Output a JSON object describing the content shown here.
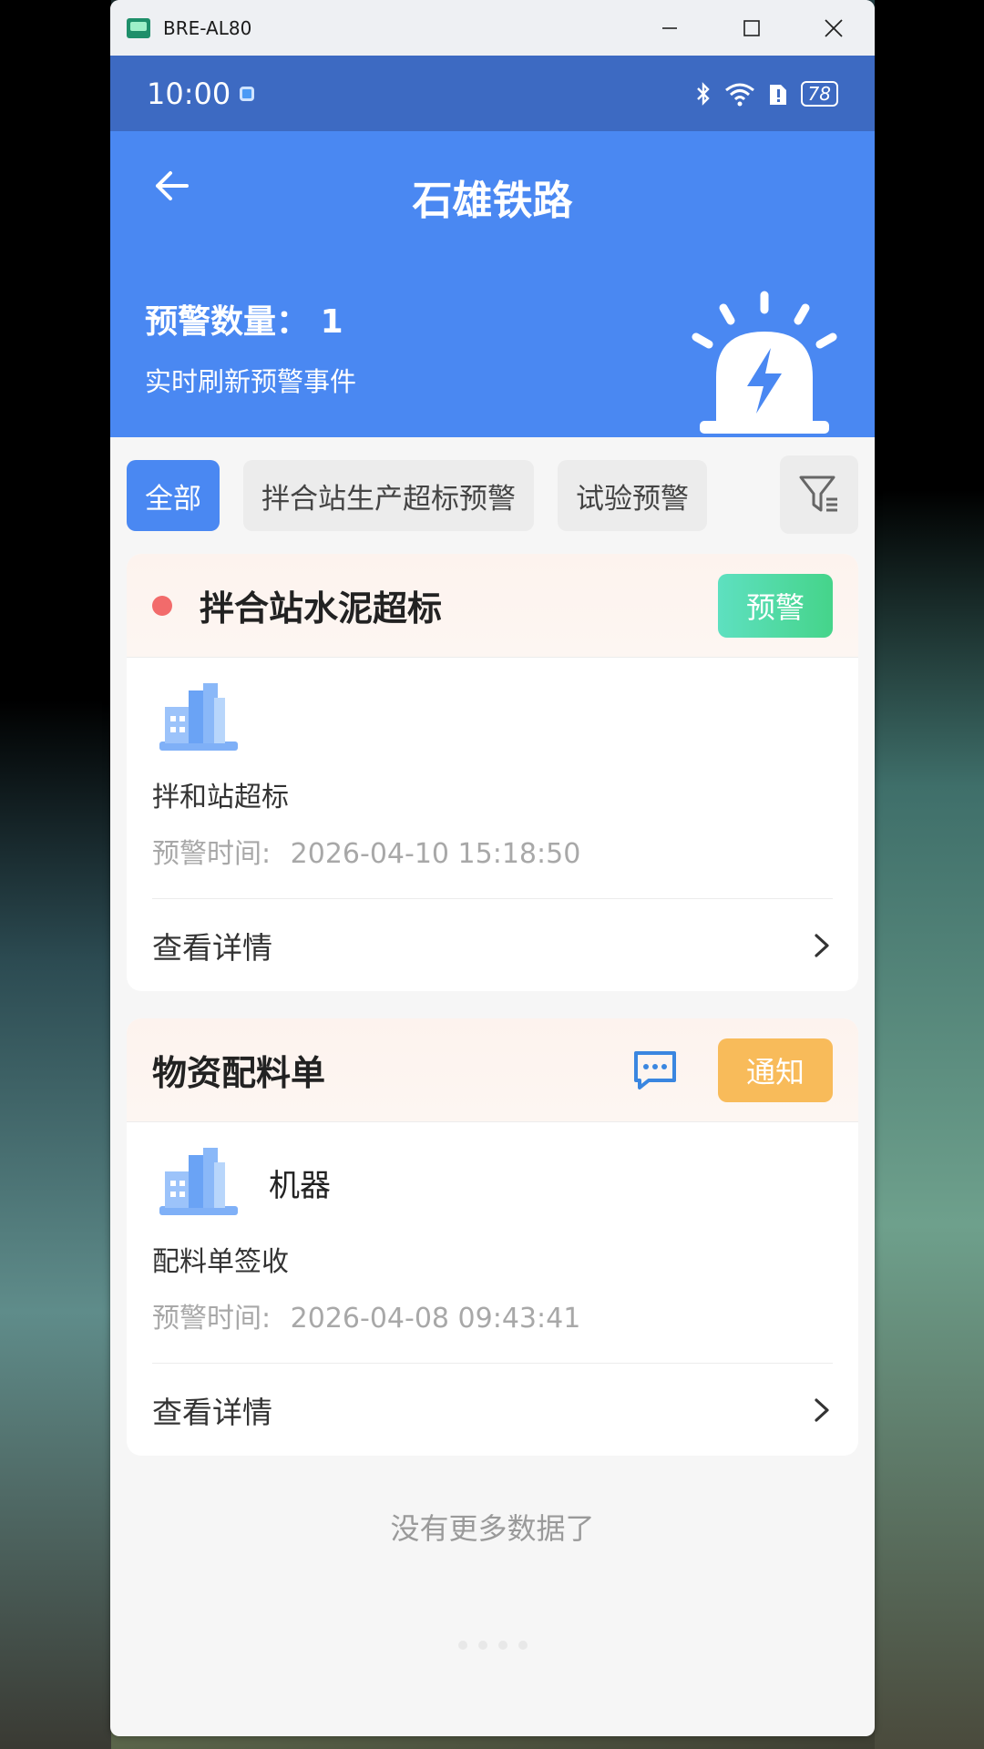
{
  "window": {
    "title": "BRE-AL80"
  },
  "statusbar": {
    "time": "10:00",
    "battery": "78"
  },
  "header": {
    "title": "石雄铁路",
    "count_label": "预警数量：",
    "count_value": "1",
    "subtitle": "实时刷新预警事件"
  },
  "filters": [
    {
      "label": "全部",
      "active": true
    },
    {
      "label": "拌合站生产超标预警",
      "active": false
    },
    {
      "label": "试验预警",
      "active": false
    }
  ],
  "cards": [
    {
      "title": "拌合站水泥超标",
      "tag": "预警",
      "building_label": "",
      "desc": "拌和站超标",
      "time_label": "预警时间:",
      "time_value": "2026-04-10 15:18:50",
      "detail": "查看详情"
    },
    {
      "title": "物资配料单",
      "tag": "通知",
      "building_label": "机器",
      "desc": "配料单签收",
      "time_label": "预警时间:",
      "time_value": "2026-04-08 09:43:41",
      "detail": "查看详情"
    }
  ],
  "footer": {
    "no_more": "没有更多数据了"
  },
  "colors": {
    "primary": "#4a88f2",
    "statusbar": "#3d6ac2",
    "warn": "#45d48a",
    "notice": "#f8bb5a",
    "alert_dot": "#f26b6b"
  }
}
